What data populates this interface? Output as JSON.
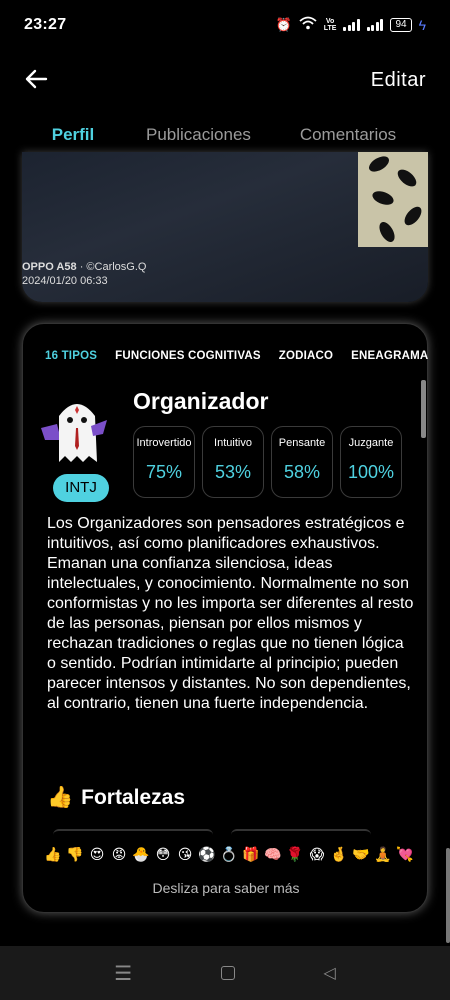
{
  "status_bar": {
    "time": "23:27",
    "battery": "94",
    "volte_top": "Vo",
    "volte_bottom": "LTE"
  },
  "header": {
    "back_icon": "arrow-left-icon",
    "edit_label": "Editar"
  },
  "tabs": [
    {
      "label": "Perfil",
      "active": true
    },
    {
      "label": "Publicaciones",
      "active": false
    },
    {
      "label": "Comentarios",
      "active": false
    }
  ],
  "photo": {
    "camera": "OPPO A58",
    "credit": "· ©CarlosG.Q",
    "date": "2024/01/20 06:33"
  },
  "personality": {
    "subtabs": [
      {
        "label": "16 TIPOS",
        "active": true
      },
      {
        "label": "FUNCIONES COGNITIVAS",
        "active": false
      },
      {
        "label": "ZODIACO",
        "active": false
      },
      {
        "label": "ENEAGRAMA",
        "active": false
      }
    ],
    "type_code": "INTJ",
    "type_name": "Organizador",
    "traits": [
      {
        "label": "Introvertido",
        "value": "75%"
      },
      {
        "label": "Intuitivo",
        "value": "53%"
      },
      {
        "label": "Pensante",
        "value": "58%"
      },
      {
        "label": "Juzgante",
        "value": "100%"
      }
    ],
    "description": "Los Organizadores son pensadores estratégicos e intuitivos, así como planificadores exhaustivos. Emanan una confianza silenciosa, ideas intelectuales, y conocimiento. Normalmente no son conformistas y no les importa ser diferentes al resto de las personas, piensan por ellos mismos y rechazan tradiciones o reglas que no tienen lógica o sentido. Podrían intimidarte al principio; pueden parecer intensos y distantes. No son dependientes, al contrario, tienen una fuerte independencia.",
    "strengths_emoji": "👍",
    "strengths_title": "Fortalezas",
    "reactions": [
      "👍",
      "👎",
      "😍",
      "😡",
      "🐣",
      "😳",
      "😘",
      "⚽",
      "💍",
      "🎁",
      "🧠",
      "🌹",
      "😱",
      "🤞",
      "🤝",
      "🧘",
      "💘"
    ],
    "swipe_hint": "Desliza para saber más"
  },
  "accent_color": "#4fd1e0"
}
